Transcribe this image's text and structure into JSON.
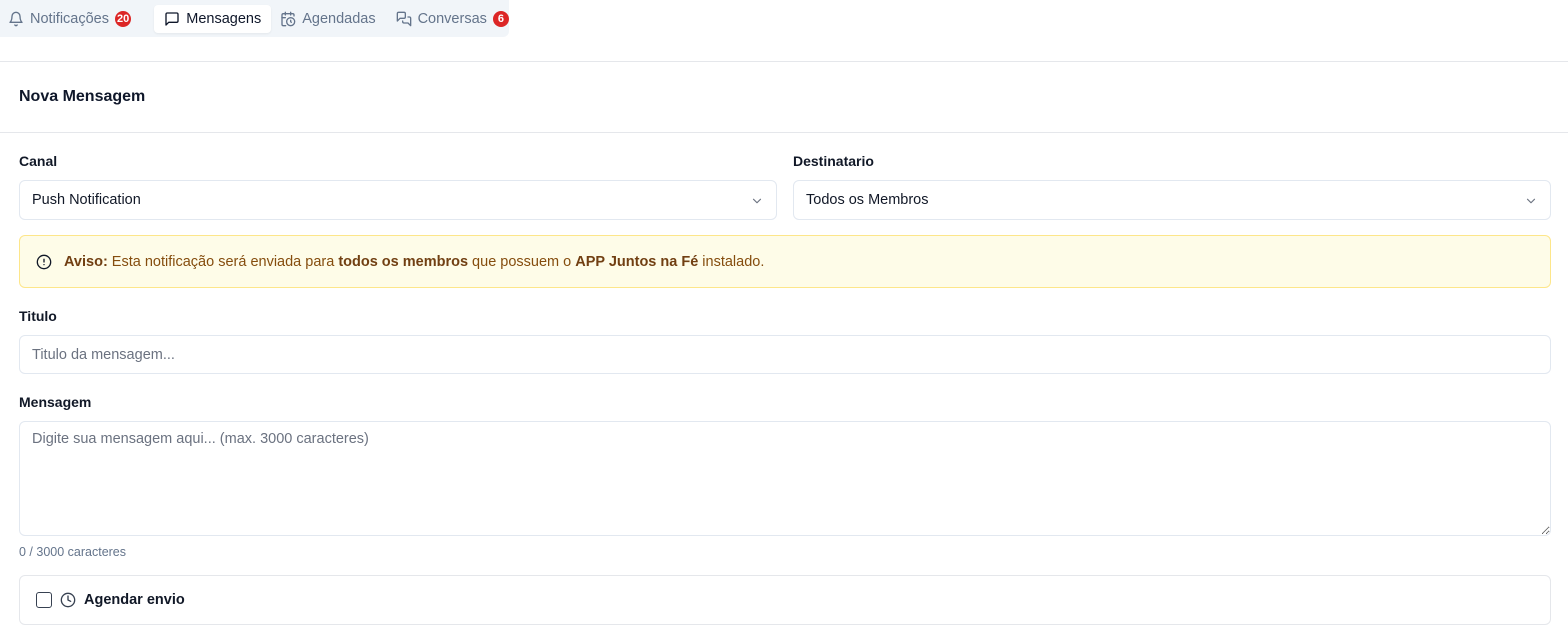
{
  "tabs": {
    "notifications": {
      "label": "Notificações",
      "badge": "20"
    },
    "messages": {
      "label": "Mensagens"
    },
    "scheduled": {
      "label": "Agendadas"
    },
    "conversations": {
      "label": "Conversas",
      "badge": "6"
    }
  },
  "form": {
    "title": "Nova Mensagem",
    "channel": {
      "label": "Canal",
      "value": "Push Notification"
    },
    "recipient": {
      "label": "Destinatario",
      "value": "Todos os Membros"
    },
    "alert": {
      "prefix": "Aviso:",
      "text1": " Esta notificação será enviada para ",
      "bold1": "todos os membros",
      "text2": " que possuem o ",
      "bold2": "APP Juntos na Fé",
      "text3": " instalado."
    },
    "subject": {
      "label": "Titulo",
      "placeholder": "Titulo da mensagem..."
    },
    "message": {
      "label": "Mensagem",
      "placeholder": "Digite sua mensagem aqui... (max. 3000 caracteres)"
    },
    "counter": "0 / 3000 caracteres",
    "schedule": {
      "label": "Agendar envio"
    }
  },
  "colors": {
    "badge": "#dc2626",
    "alert_bg": "#fefce8",
    "alert_border": "#fde68a",
    "alert_text": "#854d0e"
  }
}
